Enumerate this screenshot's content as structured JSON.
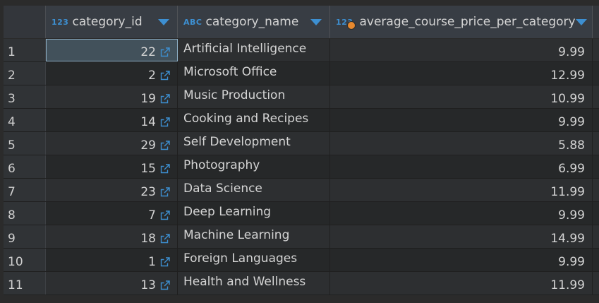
{
  "columns": [
    {
      "type_icon": "123",
      "label": "category_id"
    },
    {
      "type_icon": "ABC",
      "label": "category_name"
    },
    {
      "type_icon": "123",
      "label": "average_course_price_per_category"
    }
  ],
  "rows": [
    {
      "num": "1",
      "category_id": "22",
      "category_name": "Artificial Intelligence",
      "avg_price": "9.99"
    },
    {
      "num": "2",
      "category_id": "2",
      "category_name": "Microsoft Office",
      "avg_price": "12.99"
    },
    {
      "num": "3",
      "category_id": "19",
      "category_name": "Music Production",
      "avg_price": "10.99"
    },
    {
      "num": "4",
      "category_id": "14",
      "category_name": "Cooking and Recipes",
      "avg_price": "9.99"
    },
    {
      "num": "5",
      "category_id": "29",
      "category_name": "Self Development",
      "avg_price": "5.88"
    },
    {
      "num": "6",
      "category_id": "15",
      "category_name": "Photography",
      "avg_price": "6.99"
    },
    {
      "num": "7",
      "category_id": "23",
      "category_name": "Data Science",
      "avg_price": "11.99"
    },
    {
      "num": "8",
      "category_id": "7",
      "category_name": "Deep Learning",
      "avg_price": "9.99"
    },
    {
      "num": "9",
      "category_id": "18",
      "category_name": "Machine Learning",
      "avg_price": "14.99"
    },
    {
      "num": "10",
      "category_id": "1",
      "category_name": "Foreign Languages",
      "avg_price": "9.99"
    },
    {
      "num": "11",
      "category_id": "13",
      "category_name": "Health and Wellness",
      "avg_price": "11.99"
    }
  ],
  "icons": {
    "foreign_key_link": "external-link-icon",
    "sort": "sort-arrow-icon"
  },
  "colors": {
    "accent": "#3d8fd1",
    "warning_dot": "#e8892e",
    "selected_cell": "#42515b"
  }
}
